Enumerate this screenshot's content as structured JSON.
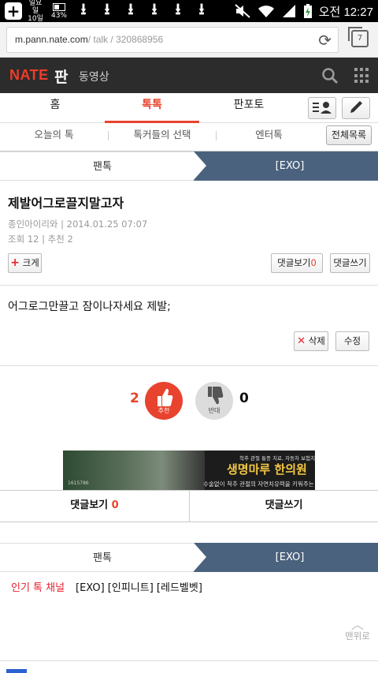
{
  "status_bar": {
    "date_line1": "일요일",
    "date_line2": "10일",
    "battery_pct": "43%",
    "download_icons": 6,
    "time": "오전 12:27"
  },
  "browser": {
    "url_domain": "m.pann.nate.com",
    "url_path": "/ talk / 320868956",
    "tab_count": "7"
  },
  "header": {
    "logo": "NATE",
    "pann": "판",
    "video": "동영상"
  },
  "main_tabs": [
    {
      "label": "홈"
    },
    {
      "label": "톡톡"
    },
    {
      "label": "판포토"
    }
  ],
  "sub_tabs": [
    {
      "label": "오늘의 톡"
    },
    {
      "label": "톡커들의 선택"
    },
    {
      "label": "엔터톡"
    }
  ],
  "all_list_label": "전체목록",
  "channel": {
    "left": "팬톡",
    "right": "[EXO]"
  },
  "post": {
    "title": "제발어그로끌지말고자",
    "author_date": "종인아이리와 |  2014.01.25 07:07",
    "stats": "조회 12  |  추천 2",
    "enlarge_label": "크게",
    "view_comments_label": "댓글보기",
    "comment_count": "0",
    "write_comment_label": "댓글쓰기",
    "body": "어그로그만끌고 잠이나자세요 제발;",
    "delete_label": "삭제",
    "edit_label": "수정"
  },
  "votes": {
    "up_count": "2",
    "up_label": "추천",
    "down_count": "0",
    "down_label": "반대"
  },
  "ad": {
    "sub1": "척추 관절 통증 치료, 자동차 보험치료",
    "title": "생명마루 한의원",
    "sub2": "수술없이 척추 관절의 자연치유력을 키워주는 치료",
    "phone": "1615786"
  },
  "bottom": {
    "view_comments_label": "댓글보기",
    "comment_count": "0",
    "write_comment_label": "댓글쓰기"
  },
  "popular": {
    "title": "인기 톡 채널",
    "items": "[EXO] [인피니트] [레드벨벳]"
  },
  "to_top_label": "맨위로",
  "colors": {
    "accent_red": "#e8432e",
    "channel_blue": "#4a627d",
    "header_dark": "#2c2c2c"
  }
}
